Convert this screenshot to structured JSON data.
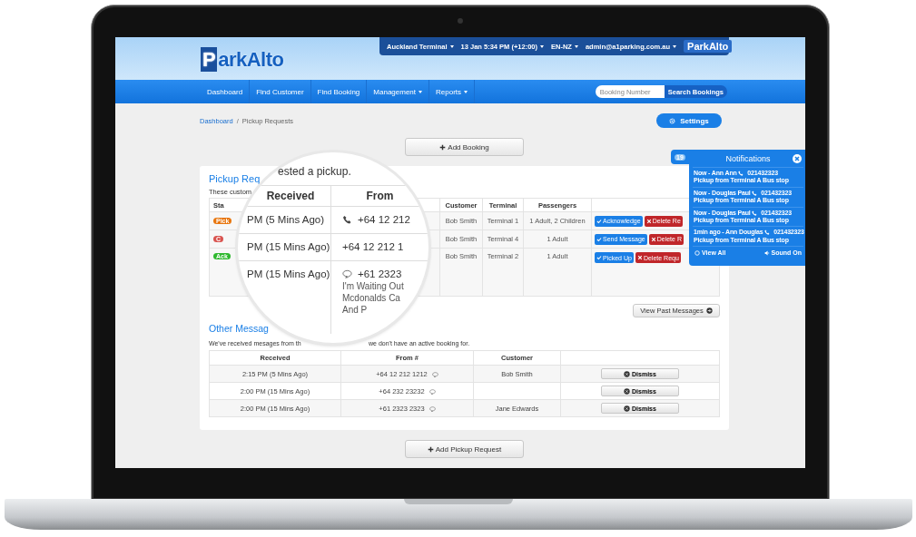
{
  "header": {
    "logo": {
      "mark": "P",
      "text": "arkAlto"
    },
    "top_bar": {
      "items": [
        {
          "label": "Auckland Terminal"
        },
        {
          "label": "13 Jan 5:34 PM (+12:00)"
        },
        {
          "label": "EN-NZ"
        },
        {
          "label": "admin@a1parking.com.au"
        }
      ],
      "logo": "ParkAlto"
    }
  },
  "nav": {
    "items": [
      {
        "label": "Dashboard",
        "dropdown": false
      },
      {
        "label": "Find Customer",
        "dropdown": false
      },
      {
        "label": "Find Booking",
        "dropdown": false
      },
      {
        "label": "Management",
        "dropdown": true
      },
      {
        "label": "Reports",
        "dropdown": true
      }
    ],
    "search": {
      "placeholder": "Booking Number",
      "button": "Search Bookings"
    }
  },
  "breadcrumb": {
    "link": "Dashboard",
    "separator": "/",
    "current": "Pickup Requests"
  },
  "settings_button": "Settings",
  "add_booking_button": "Add Booking",
  "pickup_requests": {
    "title": "Pickup Req",
    "description": "These custom",
    "status_header": "Sta",
    "columns": [
      "Customer",
      "Terminal",
      "Passengers"
    ],
    "rows": [
      {
        "status": {
          "label": "Pick",
          "color": "#e8760e"
        },
        "customer": "Bob Smith",
        "terminal": "Terminal 1",
        "passengers": "1 Adult, 2 Children",
        "actions": [
          {
            "label": "Acknowledge",
            "kind": "confirm"
          },
          {
            "label": "Delete Re",
            "kind": "delete"
          }
        ]
      },
      {
        "status": {
          "label": "C",
          "color": "#d9534f"
        },
        "customer": "Bob Smith",
        "terminal": "Terminal 4",
        "passengers": "1 Adult",
        "actions": [
          {
            "label": "Send Message",
            "kind": "confirm"
          },
          {
            "label": "Delete R",
            "kind": "delete"
          }
        ]
      },
      {
        "status": {
          "label": "Ack",
          "color": "#2eb82e"
        },
        "customer": "Bob Smith",
        "terminal": "Terminal 2",
        "passengers": "1 Adult",
        "actions": [
          {
            "label": "Picked Up",
            "kind": "confirm"
          },
          {
            "label": "Delete Requ",
            "kind": "delete"
          }
        ]
      }
    ]
  },
  "magnifier": {
    "sentence": "ested a pickup.",
    "columns": [
      "Received",
      "From"
    ],
    "rows": [
      {
        "received": "PM (5 Mins Ago)",
        "from": "+64 12 212",
        "kind": "call"
      },
      {
        "received": "PM (15 Mins Ago)",
        "from": "+64 12 212 1",
        "kind": "plain"
      },
      {
        "received": "PM (15 Mins Ago)",
        "from": "+61 2323",
        "kind": "text",
        "message": [
          "I'm Waiting Out",
          "Mcdonalds Ca",
          "And P"
        ]
      }
    ]
  },
  "view_past_messages_button": "View Past Messages",
  "other_messages": {
    "title": "Other Messag",
    "description_left": "We've received mesages from th",
    "description_right": "we don't have an active booking for.",
    "columns": [
      "Received",
      "From #",
      "Customer"
    ],
    "rows": [
      {
        "received": "2:15 PM (5 Mins Ago)",
        "from": "+64 12 212 1212",
        "customer": "Bob Smith",
        "action": "Dismiss"
      },
      {
        "received": "2:00 PM (15 Mins Ago)",
        "from": "+64 232 23232",
        "action": "Dismiss"
      },
      {
        "received": "2:00 PM (15 Mins Ago)",
        "from": "+61 2323 2323",
        "customer": "Jane Edwards",
        "action": "Dismiss"
      }
    ]
  },
  "add_pickup_request_button": "Add Pickup Request",
  "notifications": {
    "count": "19",
    "title": "Notifications",
    "items": [
      {
        "time": "Now - Ann Ann",
        "phone": "021432323",
        "text": "Pickup from Terminal A Bus stop"
      },
      {
        "time": "Now - Douglas Paul",
        "phone": "021432323",
        "text": "Pickup from Terminal A Bus stop"
      },
      {
        "time": "Now - Douglas Paul",
        "phone": "021432323",
        "text": "Pickup from Terminal A Bus stop"
      },
      {
        "time": "1min ago - Ann Douglas",
        "phone": "021432323",
        "text": "Pickup from Terminal A Bus stop"
      }
    ],
    "view_all": "View All",
    "sound": "Sound On"
  }
}
